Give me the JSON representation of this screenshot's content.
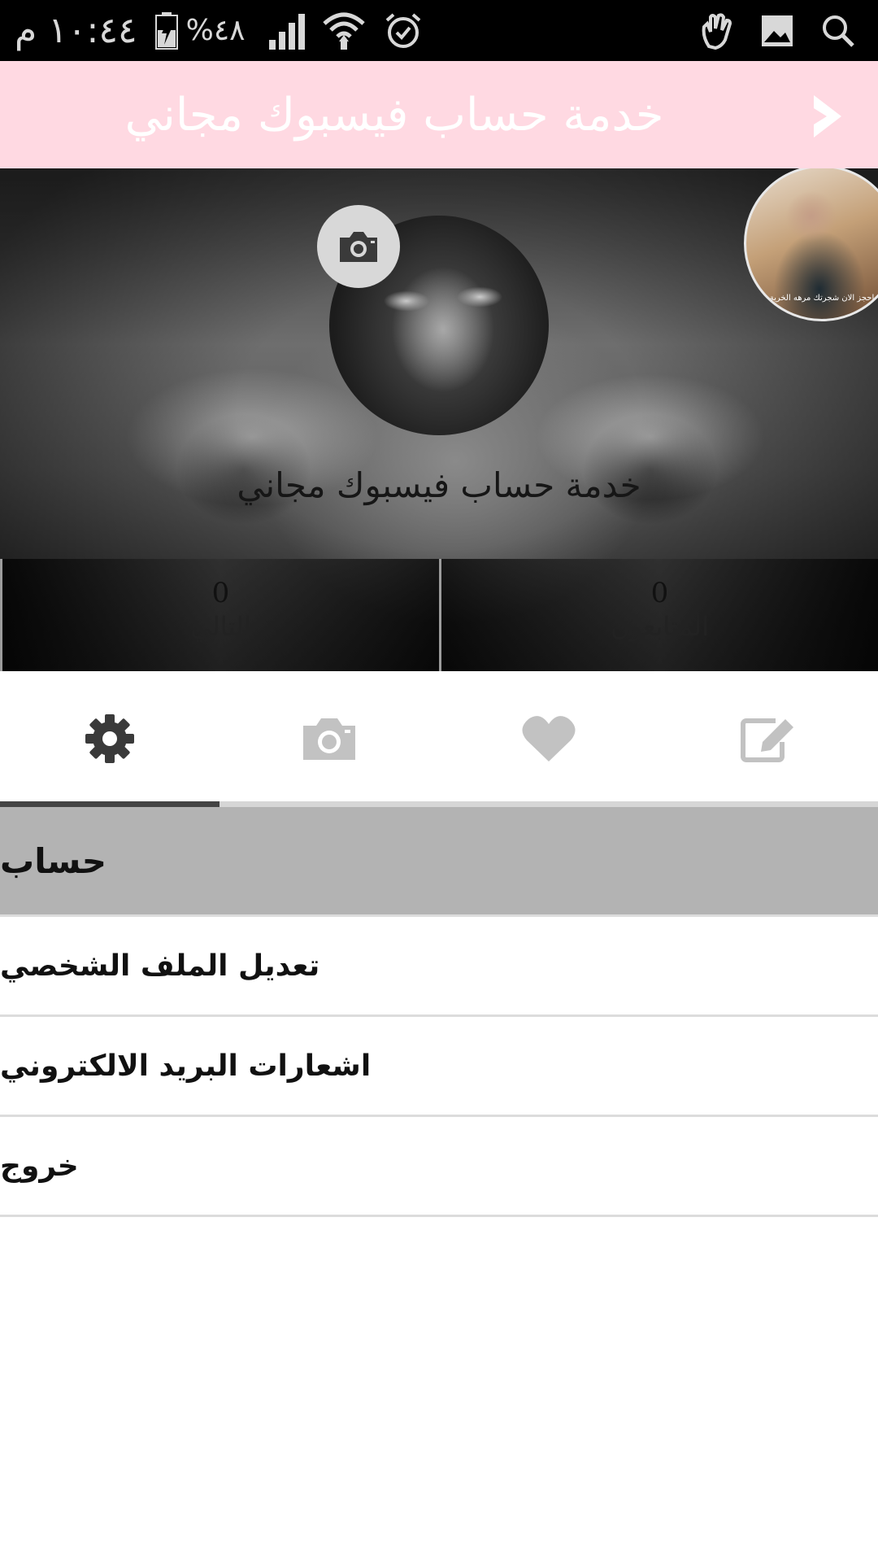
{
  "status_bar": {
    "time": "١٠:٤٤ م",
    "battery_percent": "%٤٨",
    "icons": [
      "alarm-icon",
      "wifi-icon",
      "signal-icon",
      "battery-icon",
      "gallery-icon",
      "touch-icon",
      "search-icon"
    ]
  },
  "toolbar": {
    "title": "خدمة حساب فيسبوك مجاني",
    "back_icon": "chevron-right-icon",
    "background": "#ffd9e2"
  },
  "profile": {
    "name": "خدمة حساب فيسبوك مجاني",
    "ad_caption": "احجز الان شجرتك مرهه الخرية",
    "stats": [
      {
        "count": "0",
        "label": "المتابعون"
      },
      {
        "count": "0",
        "label": "التالي"
      }
    ]
  },
  "tabs": {
    "items": [
      "edit-icon",
      "heart-icon",
      "camera-icon",
      "gear-icon"
    ],
    "selected": "gear-icon"
  },
  "settings": {
    "section_title": "حساب",
    "items": [
      {
        "label": "تعديل الملف الشخصي"
      },
      {
        "label": "اشعارات البريد الالكتروني"
      },
      {
        "label": "خروج"
      }
    ]
  },
  "colors": {
    "accent_pink": "#ffd9e2",
    "section_header": "#b3b3b3",
    "tab_indicator": "#444444"
  }
}
